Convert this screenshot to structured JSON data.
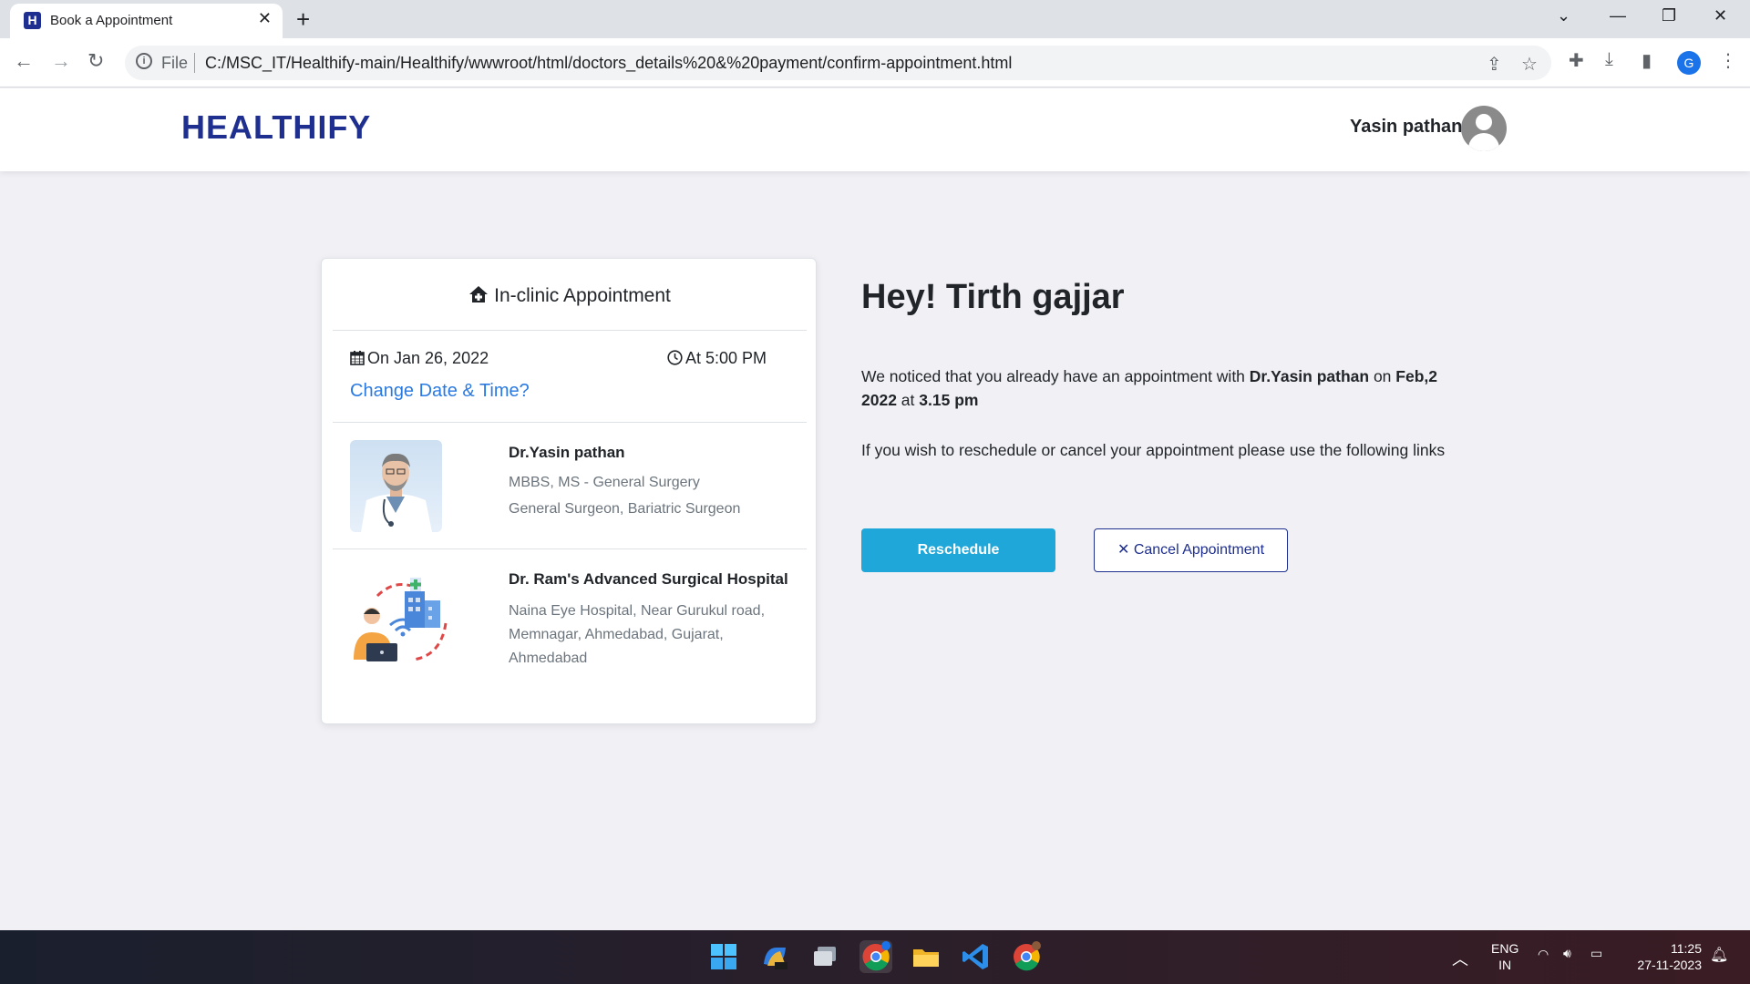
{
  "browser": {
    "tab_title": "Book a Appointment",
    "tab_favicon_letter": "H",
    "new_tab_label": "+",
    "url_scheme": "File",
    "url": "C:/MSC_IT/Healthify-main/Healthify/wwwroot/html/doctors_details%20&%20payment/confirm-appointment.html",
    "profile_letter": "G"
  },
  "header": {
    "brand": "HEALTHIFY",
    "user_name": "Yasin pathan"
  },
  "card": {
    "title": "In-clinic Appointment",
    "date": "On Jan 26, 2022",
    "time": "At 5:00 PM",
    "change_link": "Change Date & Time?",
    "doctor": {
      "name": "Dr.Yasin pathan",
      "degree": "MBBS, MS - General Surgery",
      "specialty": "General Surgeon, Bariatric Surgeon"
    },
    "hospital": {
      "name": "Dr. Ram's Advanced Surgical Hospital",
      "address": "Naina Eye Hospital, Near Gurukul road, Memnagar, Ahmedabad, Gujarat, Ahmedabad"
    }
  },
  "main": {
    "greeting": "Hey! Tirth gajjar",
    "notice_prefix": "We noticed that you already have an appointment with ",
    "notice_doctor": "Dr.Yasin pathan",
    "notice_on": " on ",
    "notice_date": "Feb,2 2022",
    "notice_at": " at ",
    "notice_time": "3.15 pm",
    "wish_text": "If you wish to reschedule or cancel your appointment please use the following links",
    "reschedule_label": "Reschedule",
    "cancel_label": "✕ Cancel Appointment"
  },
  "taskbar": {
    "lang_line1": "ENG",
    "lang_line2": "IN",
    "time": "11:25",
    "date": "27-11-2023"
  },
  "colors": {
    "brand": "#1e2f8f",
    "primary_button": "#1ea7d8",
    "link": "#2a7ae2",
    "page_bg": "#f0f0f5"
  }
}
